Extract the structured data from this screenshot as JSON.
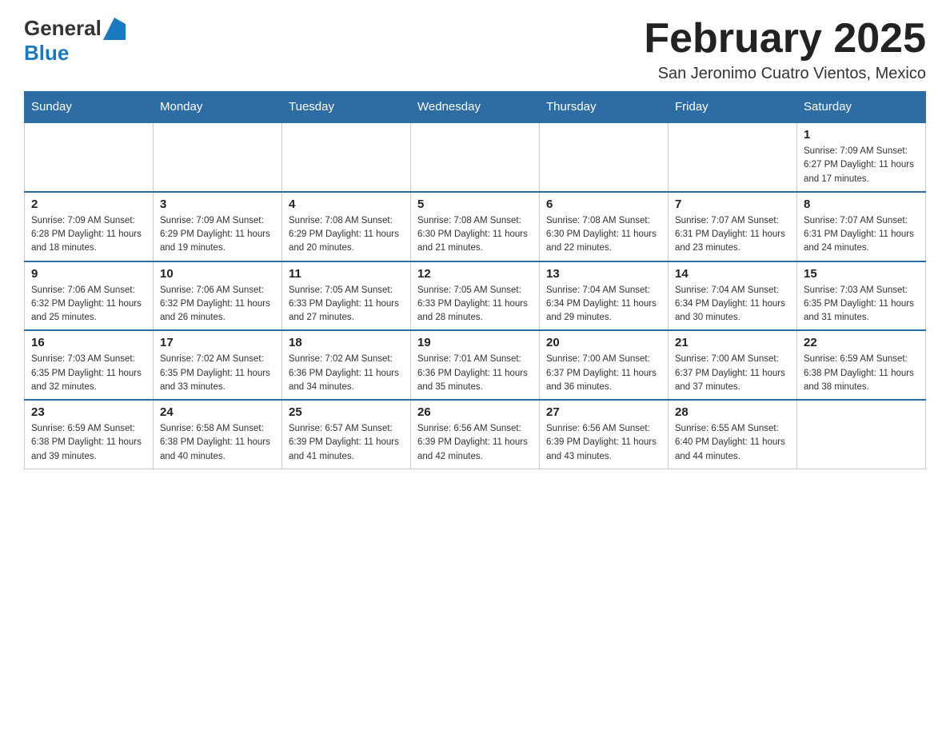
{
  "header": {
    "logo_general": "General",
    "logo_blue": "Blue",
    "month_title": "February 2025",
    "location": "San Jeronimo Cuatro Vientos, Mexico"
  },
  "days_of_week": [
    "Sunday",
    "Monday",
    "Tuesday",
    "Wednesday",
    "Thursday",
    "Friday",
    "Saturday"
  ],
  "weeks": [
    [
      {
        "day": "",
        "info": ""
      },
      {
        "day": "",
        "info": ""
      },
      {
        "day": "",
        "info": ""
      },
      {
        "day": "",
        "info": ""
      },
      {
        "day": "",
        "info": ""
      },
      {
        "day": "",
        "info": ""
      },
      {
        "day": "1",
        "info": "Sunrise: 7:09 AM\nSunset: 6:27 PM\nDaylight: 11 hours and 17 minutes."
      }
    ],
    [
      {
        "day": "2",
        "info": "Sunrise: 7:09 AM\nSunset: 6:28 PM\nDaylight: 11 hours and 18 minutes."
      },
      {
        "day": "3",
        "info": "Sunrise: 7:09 AM\nSunset: 6:29 PM\nDaylight: 11 hours and 19 minutes."
      },
      {
        "day": "4",
        "info": "Sunrise: 7:08 AM\nSunset: 6:29 PM\nDaylight: 11 hours and 20 minutes."
      },
      {
        "day": "5",
        "info": "Sunrise: 7:08 AM\nSunset: 6:30 PM\nDaylight: 11 hours and 21 minutes."
      },
      {
        "day": "6",
        "info": "Sunrise: 7:08 AM\nSunset: 6:30 PM\nDaylight: 11 hours and 22 minutes."
      },
      {
        "day": "7",
        "info": "Sunrise: 7:07 AM\nSunset: 6:31 PM\nDaylight: 11 hours and 23 minutes."
      },
      {
        "day": "8",
        "info": "Sunrise: 7:07 AM\nSunset: 6:31 PM\nDaylight: 11 hours and 24 minutes."
      }
    ],
    [
      {
        "day": "9",
        "info": "Sunrise: 7:06 AM\nSunset: 6:32 PM\nDaylight: 11 hours and 25 minutes."
      },
      {
        "day": "10",
        "info": "Sunrise: 7:06 AM\nSunset: 6:32 PM\nDaylight: 11 hours and 26 minutes."
      },
      {
        "day": "11",
        "info": "Sunrise: 7:05 AM\nSunset: 6:33 PM\nDaylight: 11 hours and 27 minutes."
      },
      {
        "day": "12",
        "info": "Sunrise: 7:05 AM\nSunset: 6:33 PM\nDaylight: 11 hours and 28 minutes."
      },
      {
        "day": "13",
        "info": "Sunrise: 7:04 AM\nSunset: 6:34 PM\nDaylight: 11 hours and 29 minutes."
      },
      {
        "day": "14",
        "info": "Sunrise: 7:04 AM\nSunset: 6:34 PM\nDaylight: 11 hours and 30 minutes."
      },
      {
        "day": "15",
        "info": "Sunrise: 7:03 AM\nSunset: 6:35 PM\nDaylight: 11 hours and 31 minutes."
      }
    ],
    [
      {
        "day": "16",
        "info": "Sunrise: 7:03 AM\nSunset: 6:35 PM\nDaylight: 11 hours and 32 minutes."
      },
      {
        "day": "17",
        "info": "Sunrise: 7:02 AM\nSunset: 6:35 PM\nDaylight: 11 hours and 33 minutes."
      },
      {
        "day": "18",
        "info": "Sunrise: 7:02 AM\nSunset: 6:36 PM\nDaylight: 11 hours and 34 minutes."
      },
      {
        "day": "19",
        "info": "Sunrise: 7:01 AM\nSunset: 6:36 PM\nDaylight: 11 hours and 35 minutes."
      },
      {
        "day": "20",
        "info": "Sunrise: 7:00 AM\nSunset: 6:37 PM\nDaylight: 11 hours and 36 minutes."
      },
      {
        "day": "21",
        "info": "Sunrise: 7:00 AM\nSunset: 6:37 PM\nDaylight: 11 hours and 37 minutes."
      },
      {
        "day": "22",
        "info": "Sunrise: 6:59 AM\nSunset: 6:38 PM\nDaylight: 11 hours and 38 minutes."
      }
    ],
    [
      {
        "day": "23",
        "info": "Sunrise: 6:59 AM\nSunset: 6:38 PM\nDaylight: 11 hours and 39 minutes."
      },
      {
        "day": "24",
        "info": "Sunrise: 6:58 AM\nSunset: 6:38 PM\nDaylight: 11 hours and 40 minutes."
      },
      {
        "day": "25",
        "info": "Sunrise: 6:57 AM\nSunset: 6:39 PM\nDaylight: 11 hours and 41 minutes."
      },
      {
        "day": "26",
        "info": "Sunrise: 6:56 AM\nSunset: 6:39 PM\nDaylight: 11 hours and 42 minutes."
      },
      {
        "day": "27",
        "info": "Sunrise: 6:56 AM\nSunset: 6:39 PM\nDaylight: 11 hours and 43 minutes."
      },
      {
        "day": "28",
        "info": "Sunrise: 6:55 AM\nSunset: 6:40 PM\nDaylight: 11 hours and 44 minutes."
      },
      {
        "day": "",
        "info": ""
      }
    ]
  ]
}
